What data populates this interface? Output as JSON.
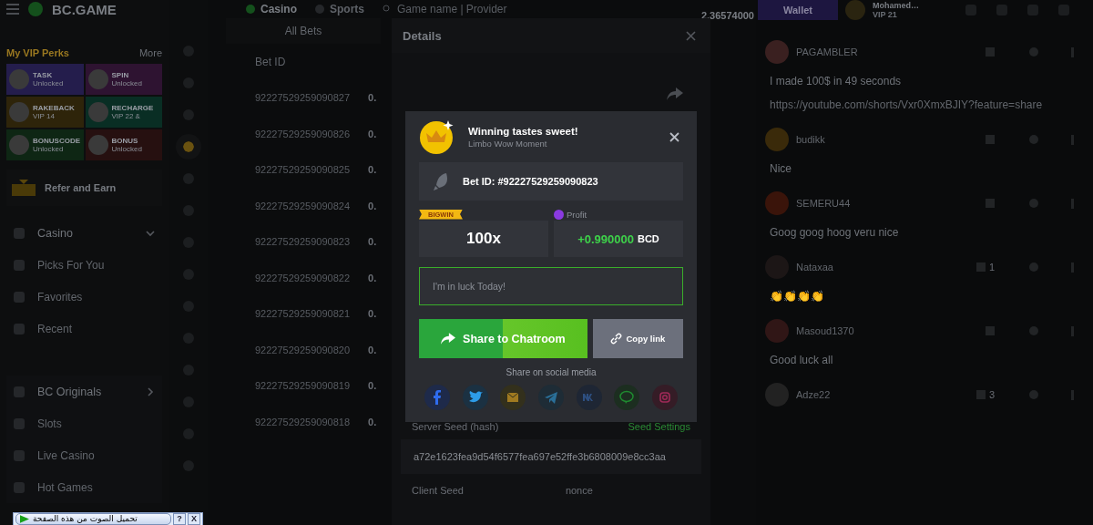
{
  "sidebar": {
    "logo": "BC.GAME",
    "perks_title": "My VIP Perks",
    "more": "More",
    "perks": [
      {
        "name": "TASK",
        "status": "Unlocked",
        "color": "#241d4c"
      },
      {
        "name": "SPIN",
        "status": "Unlocked",
        "color": "#2e1331"
      },
      {
        "name": "RAKEBACK",
        "status": "VIP 14",
        "color": "#2e240a"
      },
      {
        "name": "RECHARGE",
        "status": "VIP 22 &",
        "color": "#092e24"
      },
      {
        "name": "BONUSCODE",
        "status": "Unlocked",
        "color": "#0e2614"
      },
      {
        "name": "BONUS",
        "status": "Unlocked",
        "color": "#261010"
      }
    ],
    "refer": "Refer and Earn",
    "casino": {
      "label": "Casino",
      "expanded": true,
      "items": [
        "Picks For You",
        "Favorites",
        "Recent"
      ]
    },
    "originals": {
      "label": "BC Originals",
      "expanded": false,
      "items": [
        "Slots",
        "Live Casino",
        "Hot Games"
      ]
    }
  },
  "rail": [
    {
      "selected": false
    },
    {
      "selected": false
    },
    {
      "selected": false
    },
    {
      "selected": true
    },
    {
      "selected": false
    },
    {
      "selected": false
    },
    {
      "selected": false
    },
    {
      "selected": false
    },
    {
      "selected": false
    },
    {
      "selected": false
    },
    {
      "selected": false
    },
    {
      "selected": false
    },
    {
      "selected": false
    },
    {
      "selected": false
    }
  ],
  "topbar": {
    "tabs": [
      {
        "label": "Casino",
        "selected": true
      },
      {
        "label": "Sports",
        "selected": false
      }
    ],
    "search_placeholder": "Game name | Provider",
    "balance": "2.36574000",
    "wallet": "Wallet",
    "user": "Mohamed…",
    "vip": "VIP 21"
  },
  "bets": {
    "tab": "All Bets",
    "column": "Bet ID",
    "rows": [
      {
        "id": "92227529259090827",
        "value": "0."
      },
      {
        "id": "92227529259090826",
        "value": "0."
      },
      {
        "id": "92227529259090825",
        "value": "0."
      },
      {
        "id": "92227529259090824",
        "value": "0."
      },
      {
        "id": "92227529259090823",
        "value": "0."
      },
      {
        "id": "92227529259090822",
        "value": "0."
      },
      {
        "id": "92227529259090821",
        "value": "0."
      },
      {
        "id": "92227529259090820",
        "value": "0."
      },
      {
        "id": "92227529259090819",
        "value": "0."
      },
      {
        "id": "92227529259090818",
        "value": "0."
      }
    ]
  },
  "details": {
    "title": "Details",
    "server_seed_label": "Server Seed (hash)",
    "seed_settings": "Seed Settings",
    "server_seed": "a72e1623fea9d54f6577fea697e52ffe3b6808009e8cc3aa",
    "client_seed_label": "Client Seed",
    "nonce_label": "nonce"
  },
  "share": {
    "title": "Winning tastes sweet!",
    "subtitle": "Limbo Wow Moment",
    "bet_id": "Bet ID: #92227529259090823",
    "badge": "BIGWIN",
    "multiplier": "100x",
    "profit_label": "Profit",
    "profit": "+0.990000",
    "currency": "BCD",
    "placeholder": "I'm in luck Today!",
    "share_button": "Share to Chatroom",
    "copy_button": "Copy link",
    "social_label": "Share on social media"
  },
  "chat": [
    {
      "user": "PAGAMBLER",
      "text": "I made 100$ in 49 seconds",
      "link": "https://youtube.com/shorts/Vxr0XmxBJIY?feature=share",
      "color": "#3a2020"
    },
    {
      "user": "budikk",
      "text": "Nice",
      "color": "#3a2a0a"
    },
    {
      "user": "SEMERU44",
      "text": "Goog goog hoog veru nice",
      "color": "#3a140a"
    },
    {
      "user": "Nataxaa",
      "text": "👏👏👏👏",
      "likes": "1",
      "color": "#1c1616"
    },
    {
      "user": "Masoud1370",
      "text": "Good luck all",
      "color": "#301616"
    },
    {
      "user": "Adze22",
      "likes": "3",
      "color": "#222222"
    }
  ],
  "download_bar": {
    "label": "تحميل الصوت من هذه الصفحة",
    "help": "?",
    "close": "X"
  }
}
